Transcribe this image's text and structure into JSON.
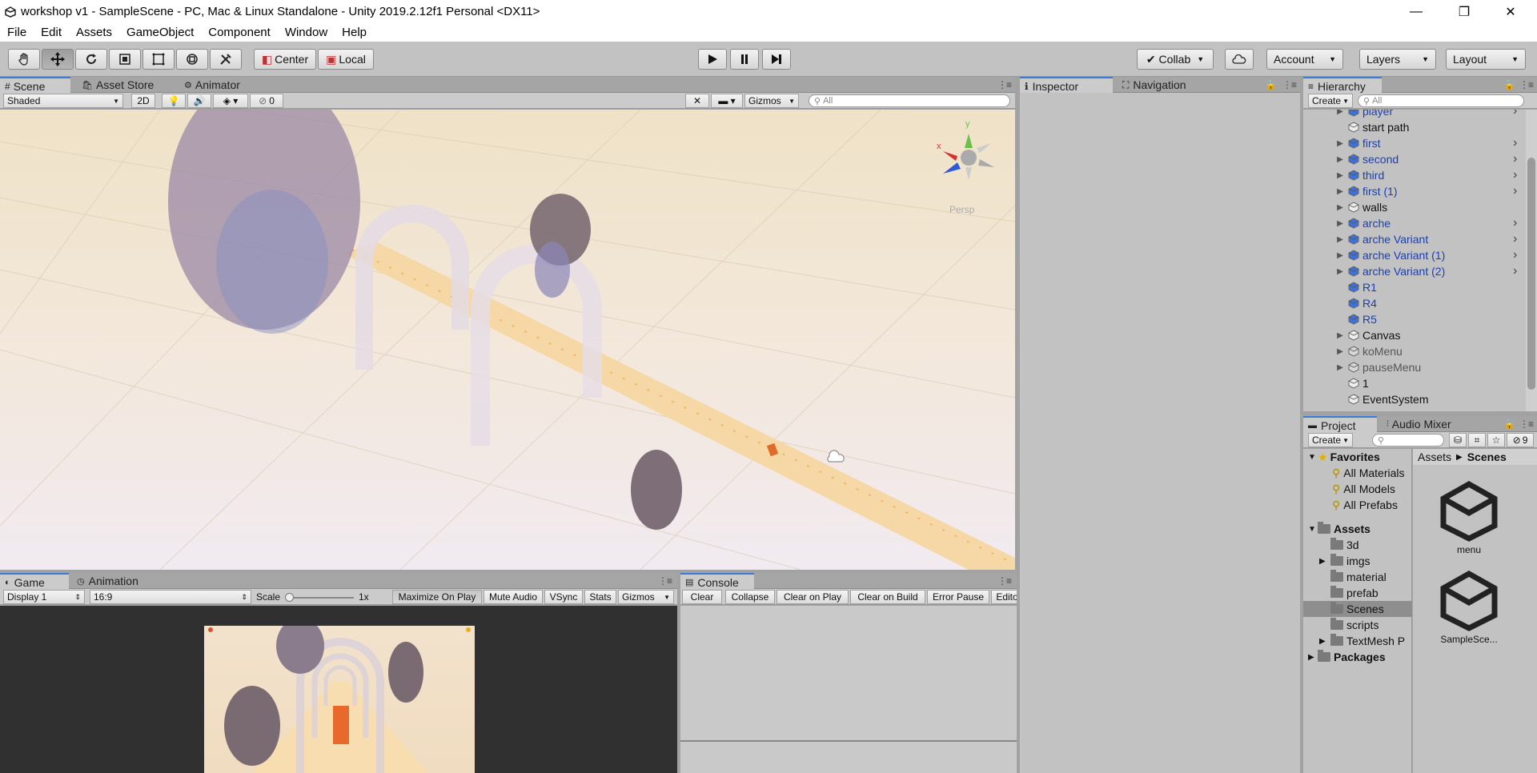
{
  "window": {
    "title": "workshop v1 - SampleScene - PC, Mac & Linux Standalone - Unity 2019.2.12f1 Personal <DX11>",
    "controls": {
      "minimize": "—",
      "restore": "❐",
      "close": "✕"
    }
  },
  "menu": [
    "File",
    "Edit",
    "Assets",
    "GameObject",
    "Component",
    "Window",
    "Help"
  ],
  "toolbar": {
    "pivot": "Center",
    "space": "Local",
    "collab": "Collab",
    "account": "Account",
    "layers": "Layers",
    "layout": "Layout"
  },
  "scene_tabs": [
    "Scene",
    "Asset Store",
    "Animator"
  ],
  "scene_bar": {
    "shading": "Shaded",
    "mode2d": "2D",
    "hidden_count": "0",
    "gizmos": "Gizmos",
    "search_placeholder": "All"
  },
  "gizmo": {
    "y": "y",
    "x": "x",
    "persp": "Persp"
  },
  "inspector_tabs": [
    "Inspector",
    "Navigation"
  ],
  "hierarchy": {
    "tab": "Hierarchy",
    "create": "Create",
    "search_placeholder": "All",
    "items": [
      {
        "label": "player",
        "style": "blue",
        "arrow": true,
        "chevron": true
      },
      {
        "label": "start path",
        "style": "normal",
        "arrow": false,
        "chevron": false
      },
      {
        "label": "first",
        "style": "blue",
        "arrow": true,
        "chevron": true
      },
      {
        "label": "second",
        "style": "blue",
        "arrow": true,
        "chevron": true
      },
      {
        "label": "third",
        "style": "blue",
        "arrow": true,
        "chevron": true
      },
      {
        "label": "first (1)",
        "style": "blue",
        "arrow": true,
        "chevron": true
      },
      {
        "label": "walls",
        "style": "normal",
        "arrow": true,
        "chevron": false
      },
      {
        "label": "arche",
        "style": "blue",
        "arrow": true,
        "chevron": true
      },
      {
        "label": "arche Variant",
        "style": "blue",
        "arrow": true,
        "chevron": true
      },
      {
        "label": "arche Variant (1)",
        "style": "blue",
        "arrow": true,
        "chevron": true
      },
      {
        "label": "arche Variant (2)",
        "style": "blue",
        "arrow": true,
        "chevron": true
      },
      {
        "label": "R1",
        "style": "blue",
        "arrow": false,
        "chevron": false
      },
      {
        "label": "R4",
        "style": "blue",
        "arrow": false,
        "chevron": false
      },
      {
        "label": "R5",
        "style": "blue",
        "arrow": false,
        "chevron": false
      },
      {
        "label": "Canvas",
        "style": "normal",
        "arrow": true,
        "chevron": false
      },
      {
        "label": "koMenu",
        "style": "grey",
        "arrow": true,
        "chevron": false
      },
      {
        "label": "pauseMenu",
        "style": "grey",
        "arrow": true,
        "chevron": false
      },
      {
        "label": "1",
        "style": "normal",
        "arrow": false,
        "chevron": false
      },
      {
        "label": "EventSystem",
        "style": "normal",
        "arrow": false,
        "chevron": false
      }
    ]
  },
  "project": {
    "tabs": [
      "Project",
      "Audio Mixer"
    ],
    "create": "Create",
    "hidden_count": "9",
    "favorites_label": "Favorites",
    "favorites": [
      "All Materials",
      "All Models",
      "All Prefabs"
    ],
    "assets_label": "Assets",
    "folders": [
      {
        "label": "3d",
        "arrow": false
      },
      {
        "label": "imgs",
        "arrow": true
      },
      {
        "label": "material",
        "arrow": false
      },
      {
        "label": "prefab",
        "arrow": false
      },
      {
        "label": "Scenes",
        "arrow": false,
        "selected": true
      },
      {
        "label": "scripts",
        "arrow": false
      },
      {
        "label": "TextMesh P",
        "arrow": true
      }
    ],
    "packages_label": "Packages",
    "breadcrumb": [
      "Assets",
      "Scenes"
    ],
    "files": [
      "menu",
      "SampleSce..."
    ]
  },
  "game": {
    "tabs": [
      "Game",
      "Animation"
    ],
    "display": "Display 1",
    "aspect": "16:9",
    "scale_label": "Scale",
    "scale_value": "1x",
    "buttons": [
      "Maximize On Play",
      "Mute Audio",
      "VSync",
      "Stats",
      "Gizmos"
    ]
  },
  "console": {
    "tab": "Console",
    "buttons": [
      "Clear",
      "Collapse",
      "Clear on Play",
      "Clear on Build",
      "Error Pause",
      "Editor"
    ]
  }
}
